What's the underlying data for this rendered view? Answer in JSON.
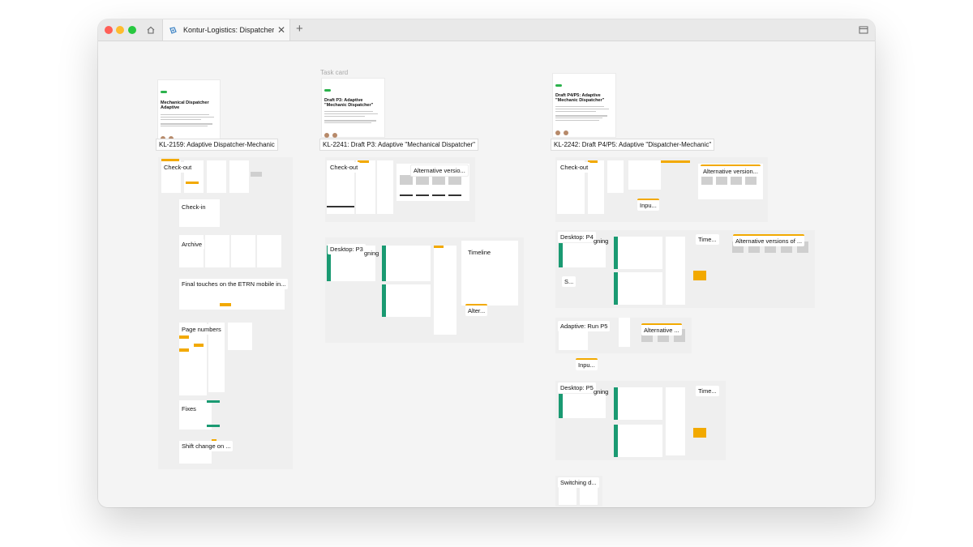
{
  "browser": {
    "tab_title": "Kontur-Logistics: Dispatcher-mec",
    "close_glyph": "✕",
    "new_tab_glyph": "+"
  },
  "canvas": {
    "task_card_caption": "Task card",
    "cards": [
      {
        "title": "Mechanical Dispatcher Adaptive",
        "label": "KL-2159: Adaptive Dispatcher-Mechanic"
      },
      {
        "title": "Draft P3: Adaptive \"Mechanic Dispatcher\"",
        "label": "KL-2241: Draft P3: Adaptive \"Mechanical Dispatcher\""
      },
      {
        "title": "Draft P4/P5: Adaptive \"Mechanic Dispatcher\"",
        "label": "KL-2242: Draft P4/P5: Adaptive \"Dispatcher-Mechanic\""
      }
    ],
    "col1_sections": [
      "Check-out",
      "Check-in",
      "Archive",
      "Final touches on the ETRN mobile in...",
      "Page numbers",
      "Fixes",
      "Shift change on ..."
    ],
    "col2_sections": [
      "Check-out",
      "Alternative versio...",
      "Desktop: P3",
      "Timeline",
      "Alter..."
    ],
    "col2_partial": "gning",
    "col3_sections": [
      "Check-out",
      "Alternative version...",
      "Inpu...",
      "Desktop: P4",
      "Time...",
      "Alternative versions of ...",
      "S...",
      "Adaptive: Run P5",
      "Alternative ...",
      "Inpu...",
      "Desktop: P5",
      "Time...",
      "Switching d..."
    ],
    "col3_partial_p4": "gning",
    "col3_partial_p5": "gning"
  },
  "colors": {
    "accent_yellow": "#f2a900",
    "accent_green": "#1a9a72",
    "tag_green": "#2bb24c"
  }
}
